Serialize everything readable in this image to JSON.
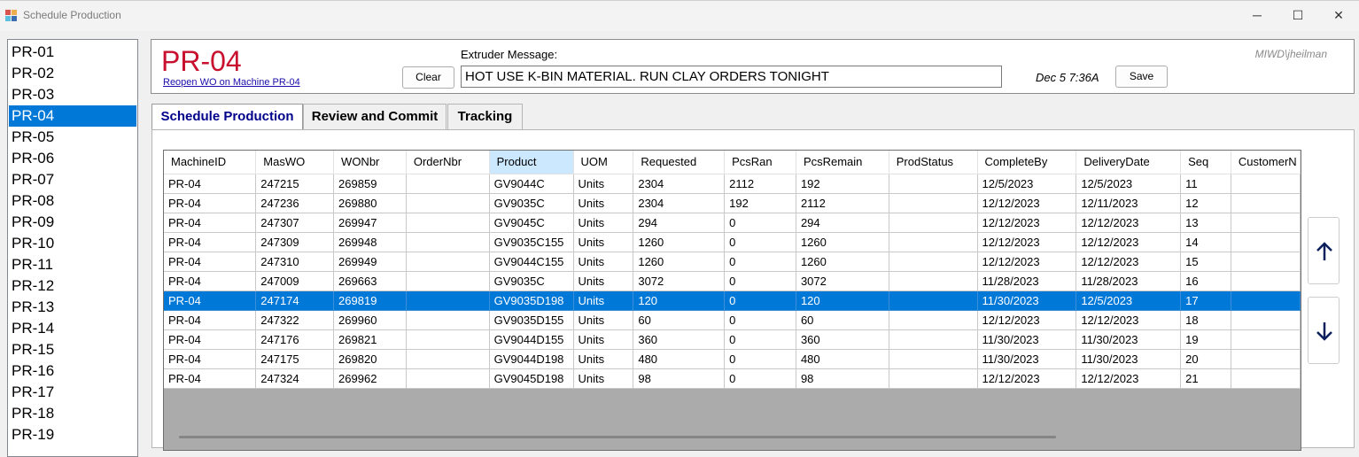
{
  "window": {
    "title": "Schedule Production",
    "min_glyph": "─",
    "max_glyph": "☐",
    "close_glyph": "✕"
  },
  "machines": {
    "items": [
      "PR-01",
      "PR-02",
      "PR-03",
      "PR-04",
      "PR-05",
      "PR-06",
      "PR-07",
      "PR-08",
      "PR-09",
      "PR-10",
      "PR-11",
      "PR-12",
      "PR-13",
      "PR-14",
      "PR-15",
      "PR-16",
      "PR-17",
      "PR-18",
      "PR-19"
    ],
    "selected": "PR-04"
  },
  "header": {
    "machine": "PR-04",
    "reopen_link": "Reopen WO on Machine PR-04",
    "clear_label": "Clear",
    "extruder_label": "Extruder Message:",
    "extruder_message": "HOT USE K-BIN MATERIAL. RUN CLAY ORDERS TONIGHT",
    "timestamp": "Dec 5 7:36A",
    "save_label": "Save",
    "user": "MIWD\\jheilman"
  },
  "tabs": [
    "Schedule Production",
    "Review and Commit",
    "Tracking"
  ],
  "active_tab": 0,
  "grid": {
    "columns": [
      "MachineID",
      "MasWO",
      "WONbr",
      "OrderNbr",
      "Product",
      "UOM",
      "Requested",
      "PcsRan",
      "PcsRemain",
      "ProdStatus",
      "CompleteBy",
      "DeliveryDate",
      "Seq",
      "CustomerN"
    ],
    "highlighted_column": "Product",
    "selected_row": 6,
    "rows": [
      [
        "PR-04",
        "247215",
        "269859",
        "",
        "GV9044C",
        "Units",
        "2304",
        "2112",
        "192",
        "",
        "12/5/2023",
        "12/5/2023",
        "11",
        ""
      ],
      [
        "PR-04",
        "247236",
        "269880",
        "",
        "GV9035C",
        "Units",
        "2304",
        "192",
        "2112",
        "",
        "12/12/2023",
        "12/11/2023",
        "12",
        ""
      ],
      [
        "PR-04",
        "247307",
        "269947",
        "",
        "GV9045C",
        "Units",
        "294",
        "0",
        "294",
        "",
        "12/12/2023",
        "12/12/2023",
        "13",
        ""
      ],
      [
        "PR-04",
        "247309",
        "269948",
        "",
        "GV9035C155",
        "Units",
        "1260",
        "0",
        "1260",
        "",
        "12/12/2023",
        "12/12/2023",
        "14",
        ""
      ],
      [
        "PR-04",
        "247310",
        "269949",
        "",
        "GV9044C155",
        "Units",
        "1260",
        "0",
        "1260",
        "",
        "12/12/2023",
        "12/12/2023",
        "15",
        ""
      ],
      [
        "PR-04",
        "247009",
        "269663",
        "",
        "GV9035C",
        "Units",
        "3072",
        "0",
        "3072",
        "",
        "11/28/2023",
        "11/28/2023",
        "16",
        ""
      ],
      [
        "PR-04",
        "247174",
        "269819",
        "",
        "GV9035D198",
        "Units",
        "120",
        "0",
        "120",
        "",
        "11/30/2023",
        "12/5/2023",
        "17",
        ""
      ],
      [
        "PR-04",
        "247322",
        "269960",
        "",
        "GV9035D155",
        "Units",
        "60",
        "0",
        "60",
        "",
        "12/12/2023",
        "12/12/2023",
        "18",
        ""
      ],
      [
        "PR-04",
        "247176",
        "269821",
        "",
        "GV9044D155",
        "Units",
        "360",
        "0",
        "360",
        "",
        "11/30/2023",
        "11/30/2023",
        "19",
        ""
      ],
      [
        "PR-04",
        "247175",
        "269820",
        "",
        "GV9044D198",
        "Units",
        "480",
        "0",
        "480",
        "",
        "11/30/2023",
        "11/30/2023",
        "20",
        ""
      ],
      [
        "PR-04",
        "247324",
        "269962",
        "",
        "GV9045D198",
        "Units",
        "98",
        "0",
        "98",
        "",
        "12/12/2023",
        "12/12/2023",
        "21",
        ""
      ]
    ]
  },
  "colors": {
    "selection": "#0078d7",
    "machine_title": "#c8102e",
    "link": "#1a0dab",
    "active_tab_text": "#00008b",
    "arrow": "#0a1f5c"
  },
  "icons": {
    "move_up": "arrow-up-icon",
    "move_down": "arrow-down-icon"
  }
}
